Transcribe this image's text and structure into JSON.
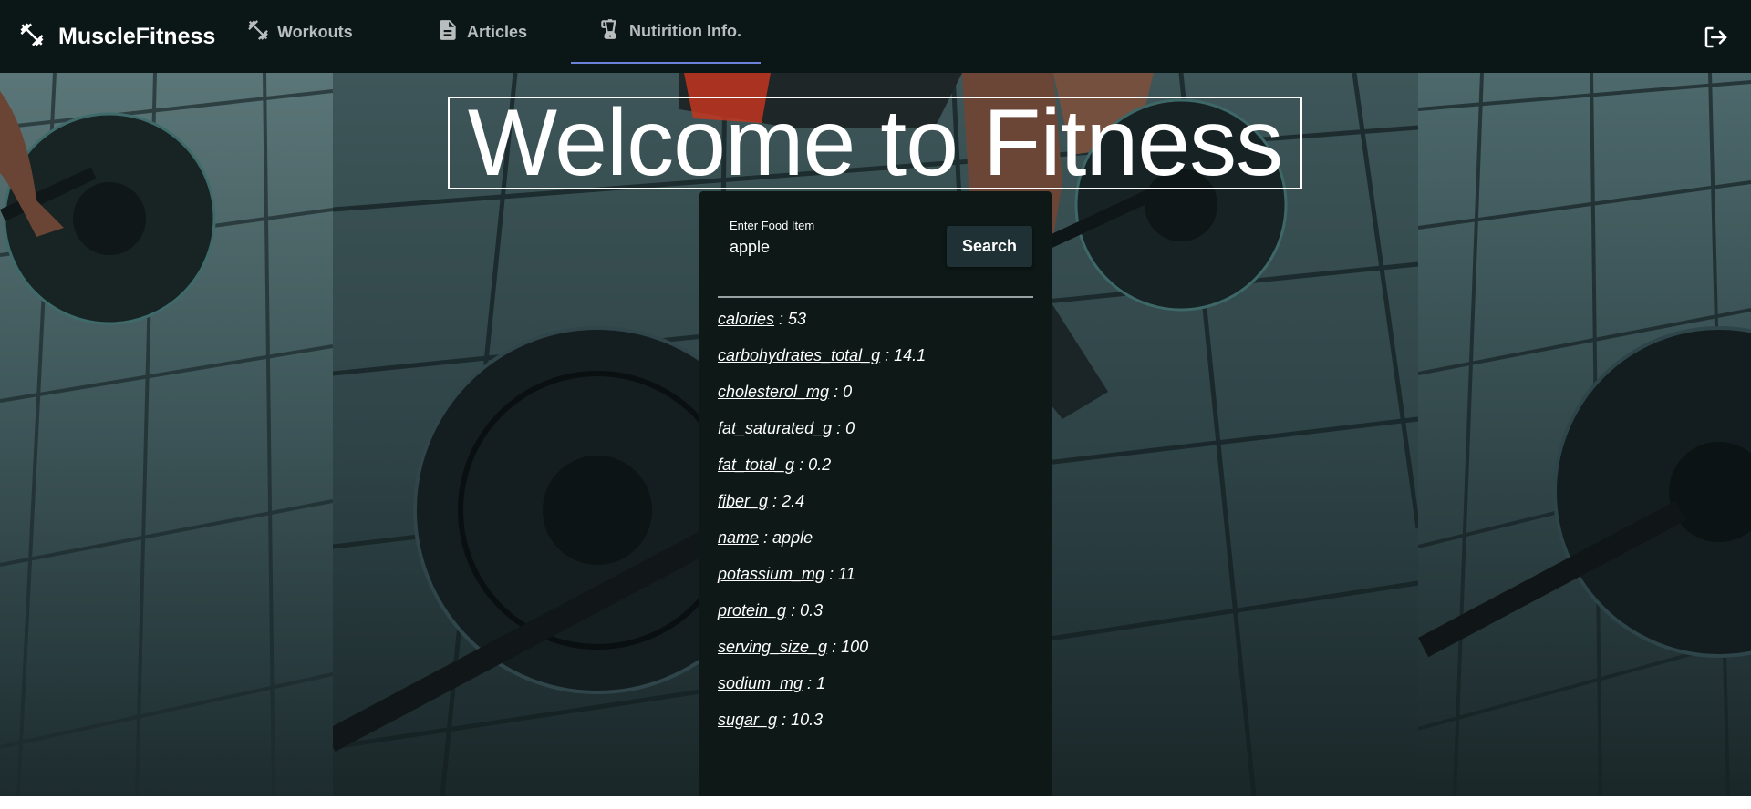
{
  "brand": {
    "name": "MuscleFitness",
    "icon": "dumbbell-icon"
  },
  "nav": {
    "tabs": [
      {
        "label": "Workouts",
        "icon": "dumbbell-icon",
        "active": false
      },
      {
        "label": "Articles",
        "icon": "article-icon",
        "active": false
      },
      {
        "label": "Nutirition Info.",
        "icon": "blender-icon",
        "active": true
      }
    ],
    "logout_icon": "logout-icon"
  },
  "hero": {
    "title": "Welcome to Fitness"
  },
  "search": {
    "label": "Enter Food Item",
    "value": "apple",
    "button_label": "Search"
  },
  "results": [
    {
      "key": "calories",
      "sep": " : ",
      "value": "53"
    },
    {
      "key": "carbohydrates_total_g",
      "sep": " : ",
      "value": "14.1"
    },
    {
      "key": "cholesterol_mg",
      "sep": " : ",
      "value": "0"
    },
    {
      "key": "fat_saturated_g",
      "sep": " : ",
      "value": "0"
    },
    {
      "key": "fat_total_g",
      "sep": " : ",
      "value": "0.2"
    },
    {
      "key": "fiber_g",
      "sep": " : ",
      "value": "2.4"
    },
    {
      "key": "name",
      "sep": " : ",
      "value": "apple"
    },
    {
      "key": "potassium_mg",
      "sep": " : ",
      "value": "11"
    },
    {
      "key": "protein_g",
      "sep": " : ",
      "value": "0.3"
    },
    {
      "key": "serving_size_g",
      "sep": " : ",
      "value": "100"
    },
    {
      "key": "sodium_mg",
      "sep": " : ",
      "value": "1"
    },
    {
      "key": "sugar_g",
      "sep": " : ",
      "value": "10.3"
    }
  ],
  "colors": {
    "navbar": "#0b1716",
    "card": "#0d1817",
    "accent": "#6c82d8",
    "button": "#1f3134"
  }
}
